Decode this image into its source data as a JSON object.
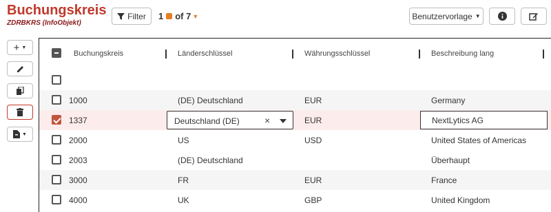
{
  "header": {
    "title": "Buchungskreis",
    "subtitle": "ZDRBKRS (InfoObjekt)",
    "filter_label": "Filter",
    "pager_current": "1",
    "pager_of": "of 7",
    "vorlage_label": "Benutzervorlage"
  },
  "grid": {
    "columns": [
      "Buchungskreis",
      "Länderschlüssel",
      "Währungsschlüssel",
      "Beschreibung lang"
    ],
    "rows": [
      {
        "code": "",
        "land": "",
        "waehrung": "",
        "beschreibung": ""
      },
      {
        "code": "1000",
        "land": "(DE) Deutschland",
        "waehrung": "EUR",
        "beschreibung": "Germany"
      },
      {
        "code": "1337",
        "land": "Deutschland (DE)",
        "waehrung": "EUR",
        "beschreibung": "NextLytics AG"
      },
      {
        "code": "2000",
        "land": "US",
        "waehrung": "USD",
        "beschreibung": "United States of Americas"
      },
      {
        "code": "2003",
        "land": "(DE) Deutschland",
        "waehrung": "",
        "beschreibung": "Überhaupt"
      },
      {
        "code": "3000",
        "land": "FR",
        "waehrung": "EUR",
        "beschreibung": "France"
      },
      {
        "code": "4000",
        "land": "UK",
        "waehrung": "GBP",
        "beschreibung": "United Kingdom"
      }
    ]
  },
  "colors": {
    "accent": "#c0392b",
    "selected_row": "#fdecec",
    "checkbox_checked": "#c0563e"
  }
}
